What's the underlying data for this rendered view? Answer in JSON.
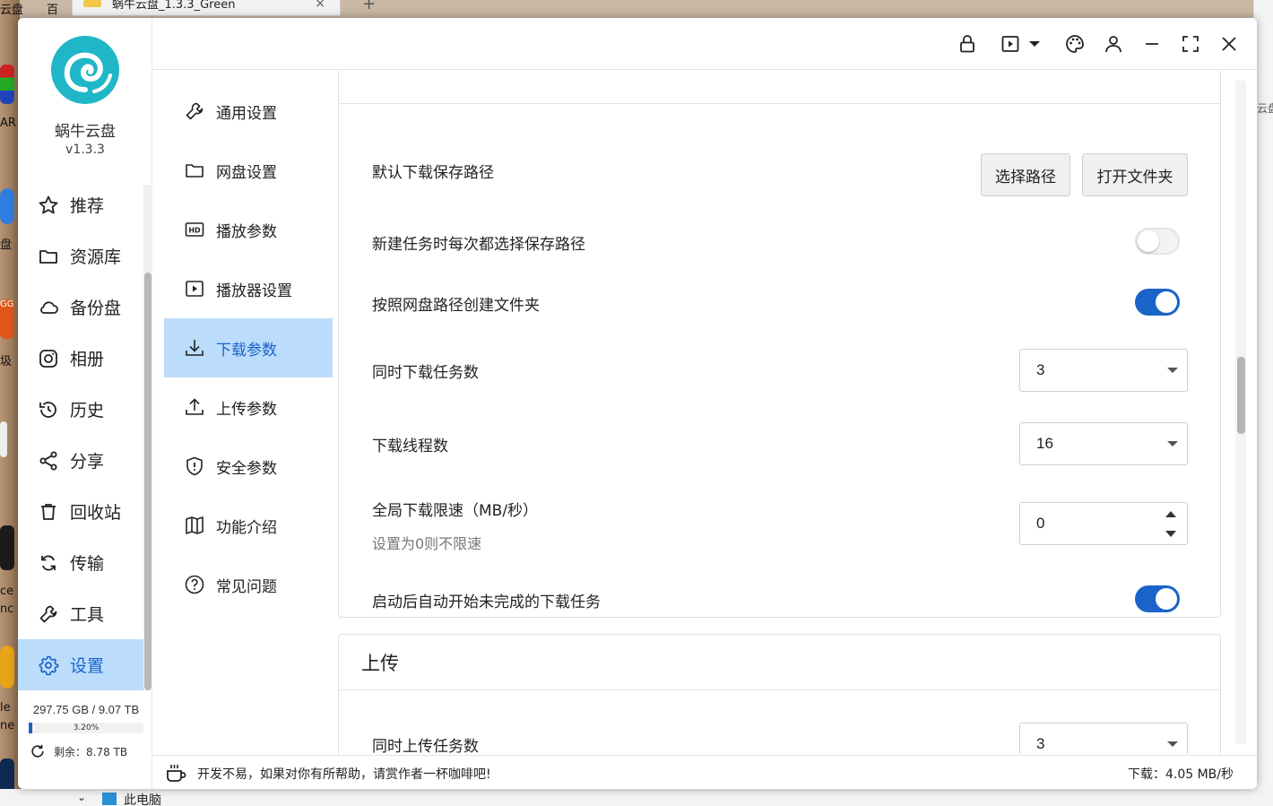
{
  "desktop": {
    "tab_title": "蜗牛云盘_1.3.3_Green",
    "left_labels": [
      "云盘",
      "AR",
      "盘",
      "GG",
      "圾",
      "ce",
      "nc",
      "le",
      "ne"
    ],
    "top_left_label": "百",
    "right_label": "云盘",
    "taskbar_item": "此电脑"
  },
  "app": {
    "name": "蜗牛云盘",
    "version": "v1.3.3"
  },
  "nav": {
    "items": [
      {
        "label": "推荐",
        "icon": "star-icon"
      },
      {
        "label": "资源库",
        "icon": "folder-icon"
      },
      {
        "label": "备份盘",
        "icon": "cloud-icon"
      },
      {
        "label": "相册",
        "icon": "camera-icon"
      },
      {
        "label": "历史",
        "icon": "history-icon"
      },
      {
        "label": "分享",
        "icon": "share-icon"
      },
      {
        "label": "回收站",
        "icon": "trash-icon"
      },
      {
        "label": "传输",
        "icon": "transfer-icon"
      },
      {
        "label": "工具",
        "icon": "wrench-icon"
      },
      {
        "label": "设置",
        "icon": "gear-icon",
        "active": true
      }
    ]
  },
  "storage": {
    "amount": "297.75 GB / 9.07 TB",
    "percent": "3.20%",
    "fill_fraction": 0.032,
    "remain": "剩余：8.78 TB"
  },
  "toolbar": {
    "icons": [
      "lock-icon",
      "play-icon",
      "dropdown-icon",
      "palette-icon",
      "user-icon",
      "minimize-icon",
      "fullscreen-icon",
      "close-icon"
    ]
  },
  "settings_menu": {
    "items": [
      {
        "label": "通用设置",
        "icon": "wrench-icon"
      },
      {
        "label": "网盘设置",
        "icon": "folder-icon"
      },
      {
        "label": "播放参数",
        "icon": "hd-icon"
      },
      {
        "label": "播放器设置",
        "icon": "player-icon"
      },
      {
        "label": "下载参数",
        "icon": "download-icon",
        "active": true
      },
      {
        "label": "上传参数",
        "icon": "upload-icon"
      },
      {
        "label": "安全参数",
        "icon": "shield-icon"
      },
      {
        "label": "功能介绍",
        "icon": "map-icon"
      },
      {
        "label": "常见问题",
        "icon": "help-icon"
      }
    ]
  },
  "download": {
    "default_path_label": "默认下载保存路径",
    "choose_path_button": "选择路径",
    "open_folder_button": "打开文件夹",
    "ask_path_label": "新建任务时每次都选择保存路径",
    "ask_path_on": false,
    "create_folder_label": "按照网盘路径创建文件夹",
    "create_folder_on": true,
    "concurrent_label": "同时下载任务数",
    "concurrent_value": "3",
    "threads_label": "下载线程数",
    "threads_value": "16",
    "limit_label": "全局下载限速（MB/秒）",
    "limit_hint": "设置为0则不限速",
    "limit_value": "0",
    "auto_start_label": "启动后自动开始未完成的下载任务",
    "auto_start_on": true
  },
  "upload": {
    "title": "上传",
    "concurrent_label": "同时上传任务数",
    "concurrent_value": "3"
  },
  "statusbar": {
    "message": "开发不易，如果对你有所帮助，请赏作者一杯咖啡吧!",
    "speed": "下载：4.05 MB/秒"
  },
  "colors": {
    "accent": "#1a63c9",
    "active_bg": "#bcdcfb",
    "logo": "#1fb7c8"
  }
}
